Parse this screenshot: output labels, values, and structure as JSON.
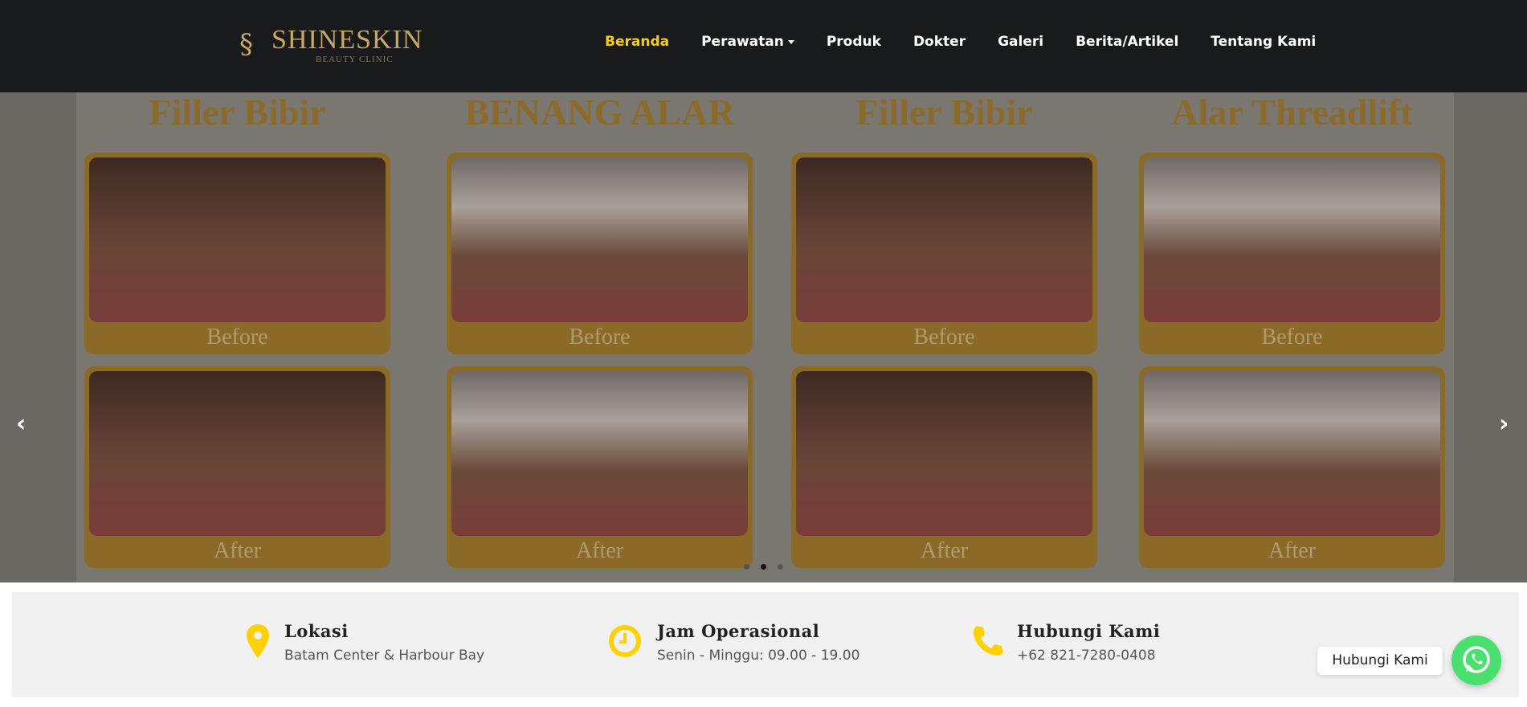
{
  "header": {
    "logo_name": "SHINESKIN",
    "logo_sub": "BEAUTY CLINIC",
    "nav": [
      "Beranda",
      "Perawatan",
      "Produk",
      "Dokter",
      "Galeri",
      "Berita/Artikel",
      "Tentang Kami"
    ]
  },
  "hero": {
    "columns": [
      {
        "title": "Filler Bibir",
        "before": "Before",
        "after": "After"
      },
      {
        "title": "BENANG ALAR",
        "before": "Before",
        "after": "After"
      },
      {
        "title": "Filler Bibir",
        "before": "Before",
        "after": "After"
      },
      {
        "title": "Alar Threadlift",
        "before": "Before",
        "after": "After"
      }
    ],
    "prev": "‹",
    "next": "›",
    "active_slide": 2,
    "slide_count": 3
  },
  "info": [
    {
      "title": "Lokasi",
      "desc": "Batam Center & Harbour Bay"
    },
    {
      "title": "Jam Operasional",
      "desc": "Senin - Minggu: 09.00 - 19.00"
    },
    {
      "title": "Hubungi Kami",
      "desc": "+62 821-7280-0408"
    }
  ],
  "whatsapp": {
    "label": "Hubungi Kami"
  },
  "colors": {
    "accent": "#ffd100",
    "header": "#191a1c",
    "whatsapp": "#4ae06f"
  }
}
